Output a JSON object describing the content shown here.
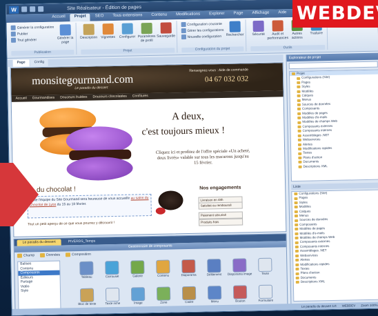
{
  "window": {
    "title": "Site Réalisateur - Édition de pages"
  },
  "menu_tabs": [
    "Accueil",
    "Projet",
    "SEO",
    "Tous extensions",
    "Contenu",
    "Modifications",
    "Explorer",
    "Page",
    "Affichage",
    "Aide"
  ],
  "active_menu_tab": 1,
  "ribbon": {
    "groups": [
      {
        "label": "Publication",
        "small": [
          "Générer la configuration",
          "Publier",
          "Tout générer"
        ],
        "buttons": [
          {
            "label": "Générer la page",
            "color": "#5b8fd6"
          }
        ]
      },
      {
        "label": "Projet",
        "buttons": [
          {
            "label": "Description",
            "color": "#c4a35a"
          },
          {
            "label": "Vignettes",
            "color": "#e0893a"
          },
          {
            "label": "Configurer",
            "color": "#5a9fd4"
          },
          {
            "label": "Paramètres de profil",
            "color": "#7aa457"
          },
          {
            "label": "Sauvegarde",
            "color": "#c24d3f"
          }
        ]
      },
      {
        "label": "Configuration du projet",
        "small": [
          "Configuration courante",
          "Gérer les configurations",
          "Nouvelle configuration"
        ],
        "buttons": [
          {
            "label": "Rechercher",
            "color": "#3e7fc9"
          }
        ]
      },
      {
        "label": "Outils",
        "buttons": [
          {
            "label": "Sécurité",
            "color": "#7d6bc7"
          },
          {
            "label": "Audit et performances",
            "color": "#cc5b3b"
          },
          {
            "label": "Autres actions",
            "color": "#5b8f3f"
          },
          {
            "label": "Traduire",
            "color": "#3d8dc4"
          }
        ]
      }
    ]
  },
  "page_tabs": [
    "Page",
    "Config"
  ],
  "site": {
    "title": "monsitegourmand.com",
    "tagline": "Le paradis du dessert",
    "order_label": "Renseignez-vous : Aide de commande",
    "phone": "04 67 032 032",
    "nav": [
      "Accueil",
      "Gourmandises",
      "Douceurs fruitées",
      "Douceurs chocolatées",
      "Confitures"
    ],
    "hero_line1": "A deux,",
    "hero_line2": "c'est toujours mieux !",
    "hero_body": "Cliquez ici et profitez de l'offre spéciale «Un acheté, deux livrés» valable sur tous les macarons jusqu'au 15 février.",
    "choco_title": "on du chocolat !",
    "choco_text": "Toute l'équipe du Site Gourmand sera heureuse de vous accueillir",
    "choco_link": "au salon du Chocolat de Lyon",
    "choco_text_end": "du 15 au 18 février.",
    "choco_extra": "Tout un petit aperçu de ce que vous pourrez y découvrir !",
    "engage_title": "Nos engagements",
    "engage_items": [
      "Livraison en 48h",
      "Satisfait ou remboursé",
      "Paiement sécurisé",
      "Produits frais"
    ]
  },
  "bottom_panel": {
    "tabs": [
      "Le paradis du dessert",
      "PIVERDS_Temps"
    ],
    "active_tab": 0,
    "header": "Gestionnaire de composants",
    "filters": [
      "Champ",
      "Données",
      "Composition"
    ],
    "list": [
      "Balises",
      "Contenu",
      "Composants",
      "Éditeurs",
      "Partage",
      "Vidéo",
      "Style"
    ],
    "selected_list_index": 2,
    "grid": [
      {
        "label": "Tableau",
        "color": "#6b8fc7"
      },
      {
        "label": "Carrousel",
        "color": "#4aa3d8"
      },
      {
        "label": "Galerie",
        "color": "#74a84a"
      },
      {
        "label": "Contenu",
        "color": "#e0a640"
      },
      {
        "label": "Diaporama",
        "color": "#c45a4a"
      },
      {
        "label": "Défilement",
        "color": "#5a7fc2"
      },
      {
        "label": "Diaporama image",
        "color": "#8a6cc7"
      },
      {
        "label": "Texte",
        "color": "#dfe6ef"
      },
      {
        "label": "Bloc de texte",
        "color": "#c9a257"
      },
      {
        "label": "Texte riche",
        "color": "#dfe6ef"
      },
      {
        "label": "Image",
        "color": "#63a1d5"
      },
      {
        "label": "Zone",
        "color": "#7bb05a"
      },
      {
        "label": "Cadre",
        "color": "#b98f4a"
      },
      {
        "label": "Menu",
        "color": "#5d86c8"
      },
      {
        "label": "Bouton",
        "color": "#c55a5a"
      },
      {
        "label": "Formulaire",
        "color": "#dfe6ef"
      }
    ]
  },
  "right_panel": {
    "header": "Explorateur de projet",
    "tree": [
      "Projet",
      "Configurations (Site)",
      "Pages",
      "Styles",
      "Modèles",
      "Calques",
      "Menus",
      "Sources de données",
      "Composants",
      "Modèles de pages",
      "Modèles d'e-mails",
      "Modèles de champs Web",
      "Composants externes",
      "Composants internes",
      "Assemblages .NET",
      "Webservices",
      "Alertes",
      "Modifications rapides",
      "Textes",
      "Plans d'action",
      "Documents",
      "Descriptions XML"
    ],
    "separator": "Liste",
    "list": [
      "Configurations (Site)",
      "Pages",
      "Styles",
      "Modèles",
      "Calques",
      "Menus",
      "Sources de données",
      "Composants",
      "Modèles de pages",
      "Modèles d'e-mails",
      "Modèles de champs Web",
      "Composants externes",
      "Composants internes",
      "Assemblages .NET",
      "Webservices",
      "Alertes",
      "Modifications rapides",
      "Textes",
      "Plans d'action",
      "Documents",
      "Descriptions XML"
    ]
  },
  "status": {
    "left": "Le paradis du dessert 1/4",
    "mode": "WEBDEV",
    "zoom": "Zoom 100%"
  },
  "badge": {
    "text": "WEBDEV"
  }
}
